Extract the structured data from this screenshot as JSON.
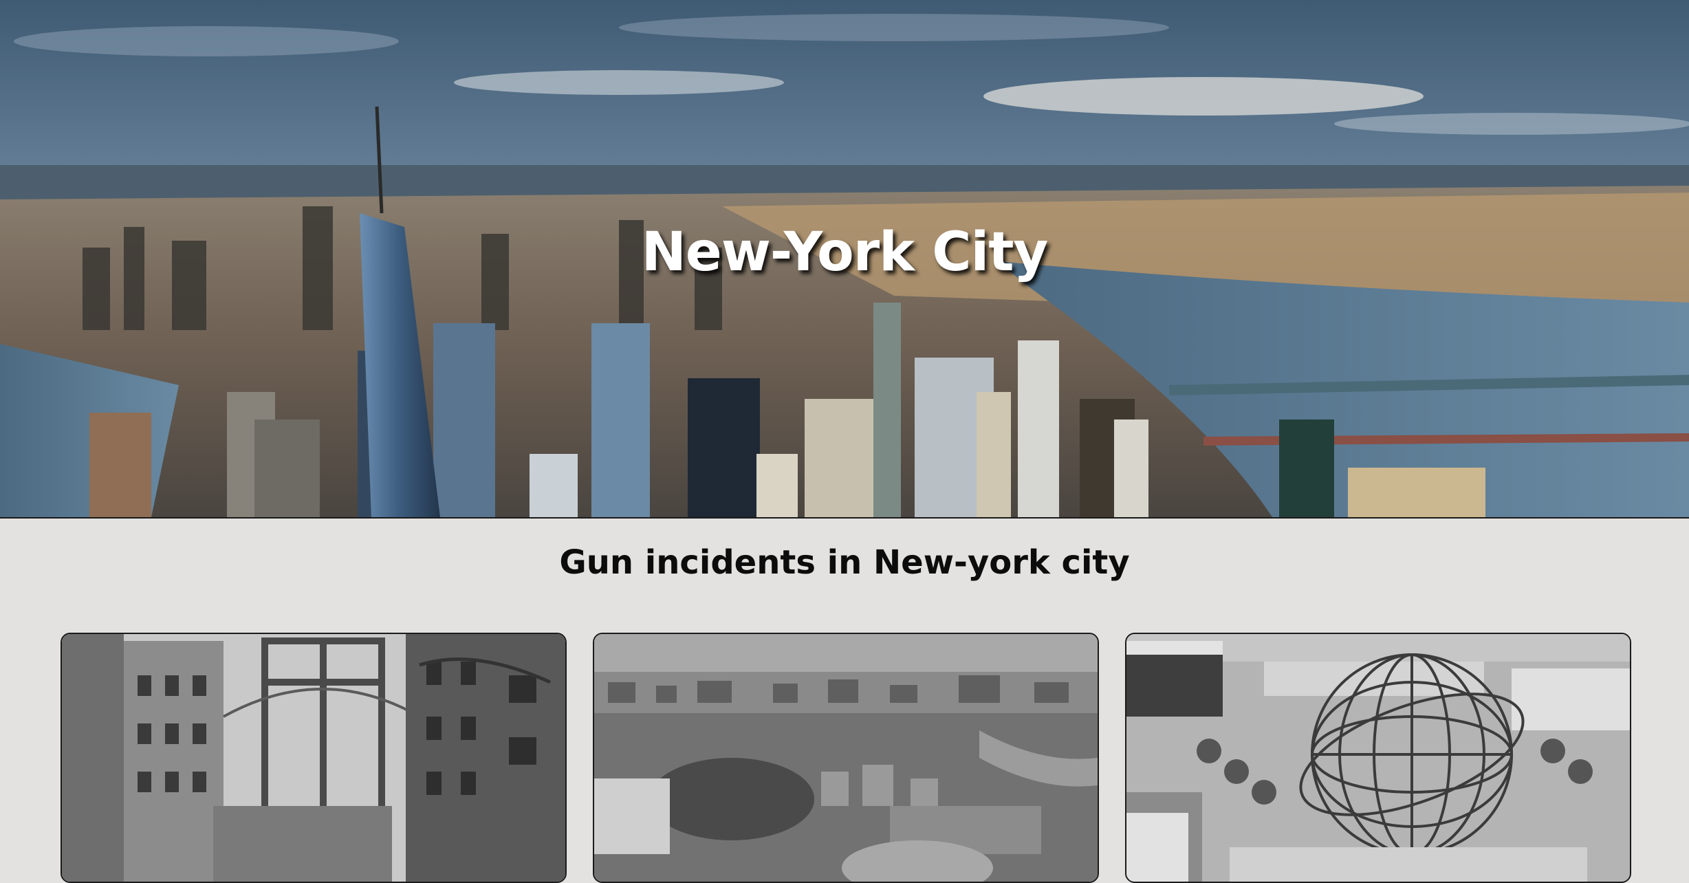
{
  "hero": {
    "title": "New-York City"
  },
  "main": {
    "section_title": "Gun incidents in New-york city",
    "cards": [
      {
        "image": "manhattan-bridge-photo"
      },
      {
        "image": "bronx-aerial-photo"
      },
      {
        "image": "unisphere-queens-photo"
      }
    ]
  },
  "colors": {
    "page_background": "#e3e2e0",
    "hero_title": "#ffffff",
    "section_title": "#0c0c0c"
  }
}
